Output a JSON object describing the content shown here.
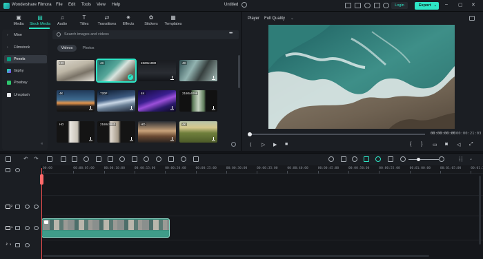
{
  "app": {
    "title": "Wondershare Filmora",
    "doc_title": "Untitled"
  },
  "menu": [
    "File",
    "Edit",
    "Tools",
    "View",
    "Help"
  ],
  "titlebar": {
    "login_label": "Login",
    "export_label": "Export",
    "accent": "#2ee6c6"
  },
  "tabs": [
    {
      "label": "Media",
      "icon": "media-icon"
    },
    {
      "label": "Stock Media",
      "icon": "stock-media-icon"
    },
    {
      "label": "Audio",
      "icon": "music-note-icon"
    },
    {
      "label": "Titles",
      "icon": "titles-icon"
    },
    {
      "label": "Transitions",
      "icon": "transitions-icon"
    },
    {
      "label": "Effects",
      "icon": "effects-icon"
    },
    {
      "label": "Stickers",
      "icon": "stickers-icon"
    },
    {
      "label": "Templates",
      "icon": "templates-icon"
    }
  ],
  "sidebar": {
    "items": [
      {
        "label": "Mine",
        "icon": "chevron-right-icon"
      },
      {
        "label": "Filmstock",
        "icon": "chevron-right-icon"
      },
      {
        "label": "Pexels",
        "icon": "pexels-icon"
      },
      {
        "label": "Giphy",
        "icon": "giphy-icon"
      },
      {
        "label": "Pixabay",
        "icon": "pixabay-icon"
      },
      {
        "label": "Unsplash",
        "icon": "unsplash-icon"
      }
    ],
    "selected": "Pexels"
  },
  "search": {
    "placeholder": "Search images and videos"
  },
  "segment": {
    "videos": "Videos",
    "photos": "Photos",
    "selected": "Videos"
  },
  "thumbnails": [
    {
      "tag": "HD"
    },
    {
      "tag": "4K"
    },
    {
      "tag": "1920x1080"
    },
    {
      "tag": "4K"
    },
    {
      "tag": "4K"
    },
    {
      "tag": "720P"
    },
    {
      "tag": "4K"
    },
    {
      "tag": "2160x4096"
    },
    {
      "tag": "HD"
    },
    {
      "tag": "2160x3840"
    },
    {
      "tag": "HD"
    },
    {
      "tag": "4K"
    }
  ],
  "player": {
    "label": "Player",
    "quality": "Full Quality",
    "time_current": "00:00:00:00",
    "time_separator": "/",
    "time_total": "00:00:21:03"
  },
  "timeline": {
    "ruler": [
      "00:00",
      "00:00:05:00",
      "00:00:10:00",
      "00:00:15:00",
      "00:00:20:00",
      "00:00:25:00",
      "00:00:30:00",
      "00:00:35:00",
      "00:00:40:00",
      "00:00:45:00",
      "00:00:50:00",
      "00:00:55:00",
      "00:01:00:00",
      "00:01:05:00",
      "00:01:10:00"
    ],
    "tracks": [
      {
        "number": "2",
        "type": "video"
      },
      {
        "number": "1",
        "type": "video"
      },
      {
        "number": "1",
        "type": "audio"
      }
    ]
  }
}
